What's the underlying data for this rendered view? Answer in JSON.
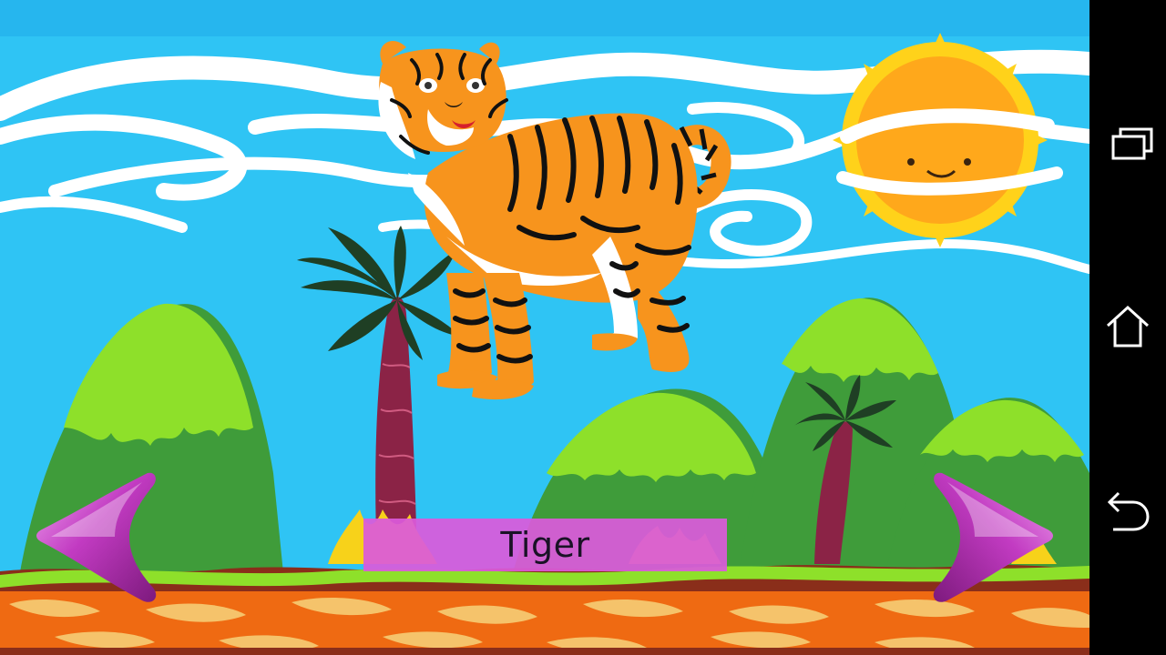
{
  "lesson": {
    "animal_name": "Tiger"
  },
  "navigation": {
    "previous_icon": "chevron-left-icon",
    "next_icon": "chevron-right-icon"
  },
  "system_nav": {
    "recents_icon": "recents-icon",
    "home_icon": "home-icon",
    "back_icon": "back-icon"
  },
  "colors": {
    "sky": "#2fc4f4",
    "caption_bg": "#da5ada",
    "arrow": "#b02ab0",
    "grass": "#8ee02a",
    "hill": "#3f9c3a",
    "tiger": "#f7941d",
    "sun": "#ffa81b",
    "ground": "#ef6a12"
  }
}
